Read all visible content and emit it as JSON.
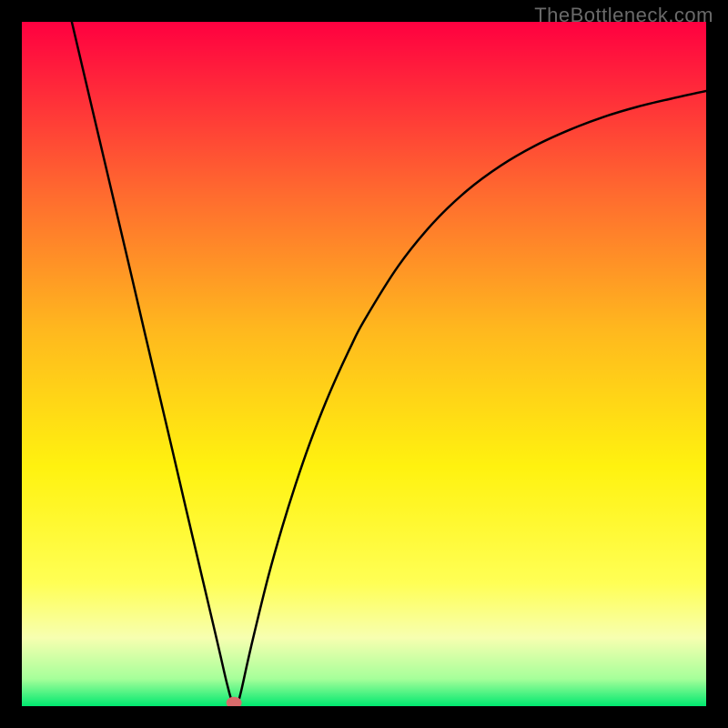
{
  "watermark": "TheBottleneck.com",
  "chart_data": {
    "type": "line",
    "title": "",
    "xlabel": "",
    "ylabel": "",
    "xlim": [
      0,
      100
    ],
    "ylim": [
      0,
      100
    ],
    "x": [
      7.3,
      10,
      12,
      14,
      16,
      18,
      20,
      22,
      24,
      26,
      28,
      29,
      30,
      30.8,
      31.5,
      32,
      33,
      34,
      36,
      38,
      40,
      42,
      44,
      46,
      48,
      50,
      55,
      60,
      65,
      70,
      75,
      80,
      85,
      90,
      95,
      100
    ],
    "y": [
      100,
      88.5,
      80,
      71.5,
      63,
      54.4,
      45.9,
      37.4,
      28.8,
      20.3,
      11.8,
      7.5,
      3.2,
      0.5,
      0.5,
      2,
      6.5,
      10.8,
      18.9,
      26,
      32.4,
      38.2,
      43.4,
      48.1,
      52.4,
      56.3,
      64.3,
      70.5,
      75.3,
      79,
      81.9,
      84.2,
      86.1,
      87.6,
      88.8,
      89.9
    ],
    "marker": {
      "x": 31,
      "y": 0.5
    },
    "gradient_stops": [
      {
        "offset": 0.0,
        "color": "#ff0040"
      },
      {
        "offset": 0.1,
        "color": "#ff2a3a"
      },
      {
        "offset": 0.25,
        "color": "#ff6a2f"
      },
      {
        "offset": 0.45,
        "color": "#ffb81e"
      },
      {
        "offset": 0.65,
        "color": "#fff20f"
      },
      {
        "offset": 0.82,
        "color": "#ffff55"
      },
      {
        "offset": 0.9,
        "color": "#f7ffb0"
      },
      {
        "offset": 0.96,
        "color": "#a6ff9a"
      },
      {
        "offset": 1.0,
        "color": "#00e86f"
      }
    ]
  }
}
